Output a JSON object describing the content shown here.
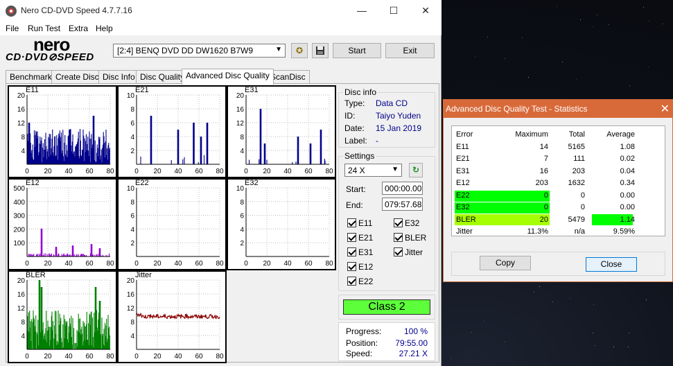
{
  "main_window": {
    "title": "Nero CD-DVD Speed 4.7.7.16",
    "controls": {
      "minimize": "—",
      "maximize": "☐",
      "close": "✕"
    },
    "menu": [
      "File",
      "Run Test",
      "Extra",
      "Help"
    ],
    "logo": {
      "brand": "nero",
      "product": "CD·DVD⊘SPEED"
    },
    "drive": "[2:4]   BENQ DVD DD DW1620 B7W9",
    "start_label": "Start",
    "exit_label": "Exit",
    "tabs": [
      "Benchmark",
      "Create Disc",
      "Disc Info",
      "Disc Quality",
      "Advanced Disc Quality",
      "ScanDisc"
    ],
    "active_tab": "Advanced Disc Quality"
  },
  "disc_info": {
    "title": "Disc info",
    "type_label": "Type:",
    "type_value": "Data CD",
    "id_label": "ID:",
    "id_value": "Taiyo Yuden",
    "date_label": "Date:",
    "date_value": "15 Jan 2019",
    "label_label": "Label:",
    "label_value": "-"
  },
  "settings": {
    "title": "Settings",
    "speed": "24 X",
    "start_label": "Start:",
    "start_value": "000:00.00",
    "end_label": "End:",
    "end_value": "079:57.68",
    "checkboxes": [
      "E11",
      "E32",
      "E21",
      "BLER",
      "E31",
      "Jitter",
      "E12",
      "E22"
    ]
  },
  "class": "Class 2",
  "progress": {
    "progress_label": "Progress:",
    "progress_value": "100 %",
    "position_label": "Position:",
    "position_value": "79:55.00",
    "speed_label": "Speed:",
    "speed_value": "27.21 X"
  },
  "chart_data": [
    {
      "type": "bar",
      "name": "E11",
      "ylim": [
        0,
        20
      ],
      "yticks": [
        20,
        16,
        12,
        8,
        4
      ],
      "xticks": [
        0,
        20,
        40,
        60,
        80
      ],
      "color": "#00008b",
      "seed": 11,
      "base": 6,
      "spread": 5,
      "peaks": [
        [
          64,
          14
        ],
        [
          2,
          12
        ]
      ]
    },
    {
      "type": "bar",
      "name": "E21",
      "ylim": [
        0,
        10
      ],
      "yticks": [
        10,
        8,
        6,
        4,
        2
      ],
      "xticks": [
        0,
        20,
        40,
        60,
        80
      ],
      "color": "#00008b",
      "seed": 21,
      "base": 0.4,
      "spread": 1.2,
      "peaks": [
        [
          14,
          7
        ],
        [
          40,
          5
        ],
        [
          55,
          6
        ],
        [
          62,
          4
        ],
        [
          68,
          6
        ]
      ]
    },
    {
      "type": "bar",
      "name": "E31",
      "ylim": [
        0,
        20
      ],
      "yticks": [
        20,
        16,
        12,
        8,
        4
      ],
      "xticks": [
        0,
        20,
        40,
        60,
        80
      ],
      "color": "#00008b",
      "seed": 31,
      "base": 0.3,
      "spread": 1.5,
      "peaks": [
        [
          14,
          16
        ],
        [
          18,
          6
        ],
        [
          50,
          8
        ],
        [
          62,
          6
        ],
        [
          72,
          10
        ]
      ]
    },
    {
      "type": "bar",
      "name": "E12",
      "ylim": [
        0,
        500
      ],
      "yticks": [
        500,
        400,
        300,
        200,
        100
      ],
      "xticks": [
        0,
        20,
        40,
        60,
        80
      ],
      "color": "#9400d3",
      "seed": 12,
      "base": 5,
      "spread": 20,
      "peaks": [
        [
          14,
          203
        ],
        [
          28,
          70
        ],
        [
          44,
          80
        ],
        [
          62,
          90
        ],
        [
          70,
          60
        ]
      ]
    },
    {
      "type": "bar",
      "name": "E22",
      "ylim": [
        0,
        10
      ],
      "yticks": [
        10,
        8,
        6,
        4,
        2
      ],
      "xticks": [
        0,
        20,
        40,
        60,
        80
      ],
      "color": "#00008b",
      "seed": 22,
      "base": 0,
      "spread": 0,
      "peaks": []
    },
    {
      "type": "bar",
      "name": "E32",
      "ylim": [
        0,
        10
      ],
      "yticks": [
        10,
        8,
        6,
        4,
        2
      ],
      "xticks": [
        0,
        20,
        40,
        60,
        80
      ],
      "color": "#00008b",
      "seed": 32,
      "base": 0,
      "spread": 0,
      "peaks": []
    },
    {
      "type": "bar",
      "name": "BLER",
      "ylim": [
        0,
        20
      ],
      "yticks": [
        20,
        16,
        12,
        8,
        4
      ],
      "xticks": [
        0,
        20,
        40,
        60,
        80
      ],
      "color": "#008000",
      "seed": 99,
      "base": 6,
      "spread": 6,
      "peaks": [
        [
          12,
          20
        ],
        [
          14,
          18
        ],
        [
          66,
          18
        ],
        [
          70,
          14
        ]
      ]
    },
    {
      "type": "line",
      "name": "Jitter",
      "ylim": [
        0,
        20
      ],
      "yticks": [
        20,
        16,
        12,
        8,
        4
      ],
      "xticks": [
        0,
        20,
        40,
        60,
        80
      ],
      "color": "#8b0000",
      "seed": 7,
      "level": 9.5,
      "spread": 0.6
    }
  ],
  "stats_dialog": {
    "title": "Advanced Disc Quality Test - Statistics",
    "close": "✕",
    "headers": [
      "Error",
      "Maximum",
      "Total",
      "Average"
    ],
    "rows": [
      [
        "E11",
        "14",
        "5165",
        "1.08"
      ],
      [
        "E21",
        "7",
        "111",
        "0.02"
      ],
      [
        "E31",
        "16",
        "203",
        "0.04"
      ],
      [
        "E12",
        "203",
        "1632",
        "0.34"
      ],
      [
        "E22",
        "0",
        "0",
        "0.00"
      ],
      [
        "E32",
        "0",
        "0",
        "0.00"
      ],
      [
        "BLER",
        "20",
        "5479",
        "1.14"
      ],
      [
        "Jitter",
        "11.3%",
        "n/a",
        "9.59%"
      ]
    ],
    "highlight_green": "#00ff00",
    "highlight_lime": "#a6ff00",
    "copy_label": "Copy",
    "close_label": "Close"
  }
}
